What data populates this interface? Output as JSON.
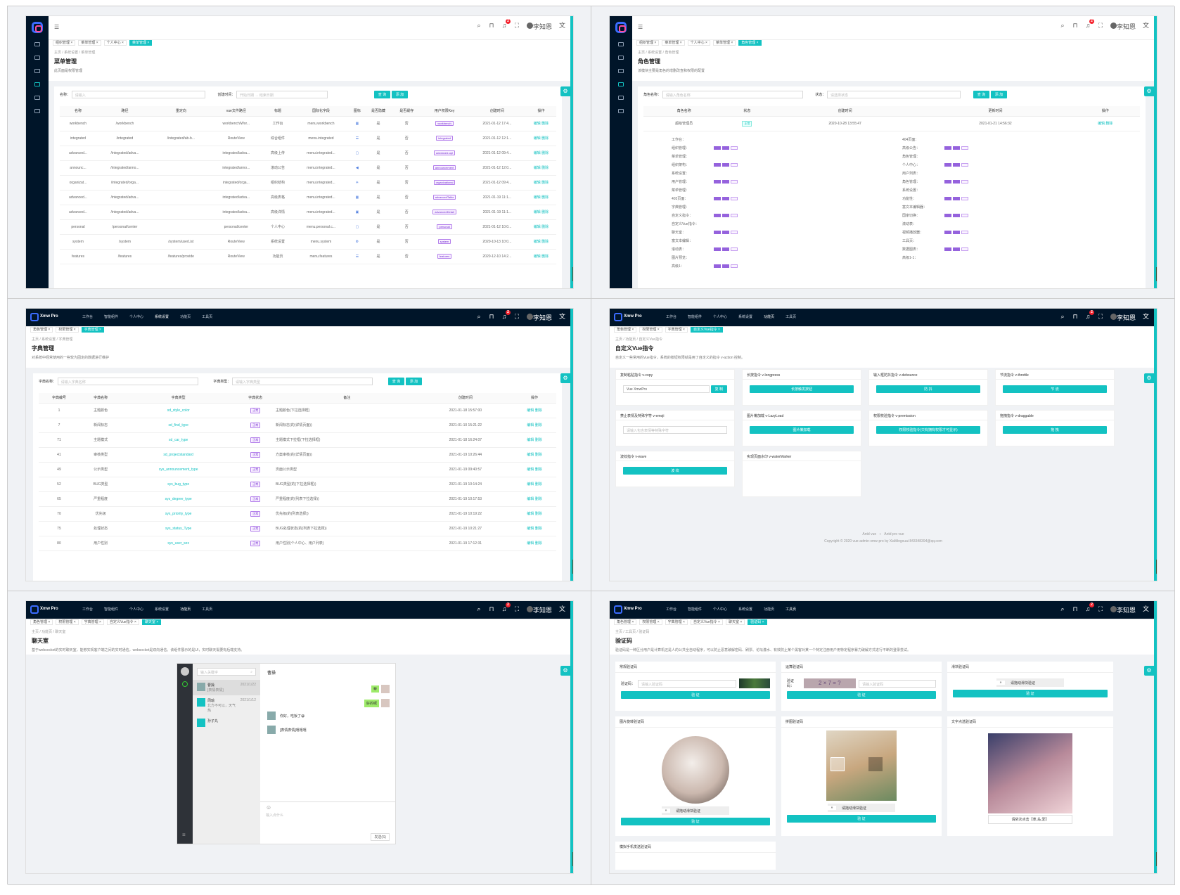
{
  "common": {
    "user_name": "李知恩",
    "notice_count": "2",
    "brand": "Xmw Pro",
    "top_nav": [
      "工作台",
      "智能组件",
      "个人中心",
      "系统设置",
      "功能页",
      "工具页"
    ]
  },
  "p1": {
    "tabs": [
      "组织管理 ×",
      "菜单管理 ×",
      "个人中心 ×",
      "菜单管理 ×"
    ],
    "crumb": "主页 / 系统设置 / 菜单管理",
    "title": "菜单管理",
    "desc": "此页面是权限管理",
    "search": {
      "name_label": "名称：",
      "name_ph": "请输入",
      "time_label": "创建时间：",
      "start_ph": "开始日期",
      "end_ph": "结束日期",
      "query": "查 询",
      "add": "添 加"
    },
    "columns": [
      "名称",
      "路径",
      "重定向",
      "vue文件路径",
      "标题",
      "国际化字段",
      "图标",
      "是否隐藏",
      "是否缓存",
      "用户权限Key",
      "创建时间",
      "操作"
    ],
    "rows": [
      [
        "workbench",
        "/workbench",
        "",
        "workbench/Wor...",
        "工作台",
        "menu.workbench",
        "",
        "是",
        "否",
        "workbench",
        "2021-01-12 17:4...",
        "编辑",
        "删除"
      ],
      [
        "integrated",
        "/integrated",
        "/integrated/ab-b...",
        "RouteView",
        "综合组件",
        "menu.integrated",
        "",
        "是",
        "否",
        "integrated",
        "2021-01-12 12:1...",
        "编辑",
        "删除"
      ],
      [
        "advanced...",
        "/integrated/adva...",
        "",
        "integrated/adva...",
        "高级上传",
        "menu.integrated...",
        "",
        "是",
        "否",
        "advanced-upl",
        "2021-01-12 09:4...",
        "编辑",
        "删除"
      ],
      [
        "announc...",
        "/integrated/anno...",
        "",
        "integrated/anno...",
        "滚动公告",
        "menu.integrated...",
        "",
        "是",
        "否",
        "announcement",
        "2021-01-12 12:0...",
        "编辑",
        "删除"
      ],
      [
        "organizat...",
        "/integrated/orga...",
        "",
        "integrated/orga...",
        "组织结构",
        "menu.integrated...",
        "",
        "是",
        "否",
        "organizational",
        "2021-01-12 09:4...",
        "编辑",
        "删除"
      ],
      [
        "advanced...",
        "/integrated/adva...",
        "",
        "integrated/adva...",
        "高级表格",
        "menu.integrated...",
        "",
        "是",
        "否",
        "advancedTable",
        "2021-01-19 11:1...",
        "编辑",
        "删除"
      ],
      [
        "advanced...",
        "/integrated/adva...",
        "",
        "integrated/adva...",
        "高级详情",
        "menu.integrated...",
        "",
        "是",
        "否",
        "advancedDetail",
        "2021-01-19 11:1...",
        "编辑",
        "删除"
      ],
      [
        "personal",
        "/personal/center",
        "",
        "personal/center",
        "个人中心",
        "menu.personal.c...",
        "",
        "是",
        "否",
        "personal",
        "2021-01-12 10:0...",
        "编辑",
        "删除"
      ],
      [
        "system",
        "/system",
        "/system/userList",
        "RouteView",
        "系统设置",
        "menu.system",
        "",
        "是",
        "否",
        "system",
        "2020-10-13 10:0...",
        "编辑",
        "删除"
      ],
      [
        "features",
        "/features",
        "/features/provide",
        "RouteView",
        "功能页",
        "menu.features",
        "",
        "是",
        "否",
        "features",
        "2020-12-10 14:2...",
        "编辑",
        "删除"
      ]
    ]
  },
  "p2": {
    "tabs": [
      "组织管理 ×",
      "菜单管理 ×",
      "个人中心 ×",
      "菜单管理 ×",
      "角色管理 ×"
    ],
    "crumb": "主页 / 系统设置 / 角色管理",
    "title": "角色管理",
    "desc": "该模块主要是角色的增删改查和权限的配置",
    "search": {
      "name_label": "角色名称：",
      "name_ph": "请输入角色名称",
      "state_label": "状态：",
      "state_ph": "请选择状态",
      "query": "查 询",
      "add": "添 加"
    },
    "columns": [
      "角色名称",
      "状态",
      "创建时间",
      "更新时间",
      "操作"
    ],
    "row": [
      "超级管理员",
      "正常",
      "2020-10-28 13:55:47",
      "2021-01-21 14:56:32",
      "编辑",
      "删除"
    ],
    "left_perms": [
      "工作台：",
      "组织管理：",
      "菜单管理：",
      "组织架构：",
      "系统设置：",
      "用户管理：",
      "菜单管理：",
      "403页面：",
      "字典管理：",
      "自定义指令：",
      "自定义Vue指令：",
      "聊天室：",
      "富文本编辑：",
      "滚动表：",
      "图片预览：",
      "高级1："
    ],
    "right_perms": [
      "404页面：",
      "高级公告：",
      "角色管理：",
      "个人中心：",
      "用户列表：",
      "角色管理：",
      "系统设置：",
      "功能性：",
      "富文本编辑器：",
      "国家切换：",
      "滚动表：",
      "视频播放器：",
      "工具页：",
      "数据图表：",
      "高级1-1："
    ]
  },
  "p3": {
    "tabs": [
      "角色管理 ×",
      "权限管理 ×",
      "字典管理 ×"
    ],
    "crumb": "主页 / 系统设置 / 字典管理",
    "title": "字典管理",
    "desc": "对系统中经常使用的一些较为固定的数据进行维护",
    "search": {
      "name_label": "字典名称：",
      "name_ph": "请输入字典名称",
      "type_label": "字典类型：",
      "type_ph": "请输入字典类型",
      "query": "查 询",
      "add": "添 加"
    },
    "columns": [
      "字典编号",
      "字典名称",
      "字典类型",
      "字典状态",
      "备注",
      "创建时间",
      "操作"
    ],
    "rows": [
      [
        "1",
        "主题颜色",
        "sd_style_color",
        "正常",
        "主题颜色(下拉选择框)",
        "2021-01-18 15:57:00"
      ],
      [
        "7",
        "新闻标志",
        "sd_find_type",
        "正常",
        "新闻标志(的(详情页面))",
        "2021-01-10 15:21:22"
      ],
      [
        "71",
        "主题模式",
        "sd_car_type",
        "正常",
        "主题模式下拉框(下拉选择框)",
        "2021-01-18 16:24:07"
      ],
      [
        "41",
        "审核类型",
        "sd_projectstandard",
        "正常",
        "方案审核(的(详情页面))",
        "2021-01-19 10:26:44"
      ],
      [
        "49",
        "公示类型",
        "sys_announcement_type",
        "正常",
        "页面公示类型",
        "2021-01-19 09:40:57"
      ],
      [
        "52",
        "BUG类型",
        "sys_bug_type",
        "正常",
        "BUG类型(的(下拉选择框))",
        "2021-01-19 10:14:24"
      ],
      [
        "65",
        "严重程度",
        "sys_degree_type",
        "正常",
        "严重程度(的(列表下拉选择))",
        "2021-01-19 10:17:53"
      ],
      [
        "70",
        "优先级",
        "sys_priority_type",
        "正常",
        "优先级(的(列表选择))",
        "2021-01-19 10:19:22"
      ],
      [
        "75",
        "处理状态",
        "sys_status_Type",
        "正常",
        "BUG处理状态(的(列表下拉选择))",
        "2021-01-19 10:21:27"
      ],
      [
        "80",
        "用户性别",
        "sys_user_sex",
        "正常",
        "用户性别(个人中心、用户列表)",
        "2021-01-19 17:12:31"
      ]
    ],
    "edit": "编辑",
    "del": "删除"
  },
  "p4": {
    "tabs": [
      "角色管理 ×",
      "权限管理 ×",
      "字典管理 ×",
      "自定义Vue指令 ×"
    ],
    "crumb": "主页 / 功能页 / 自定义Vue指令",
    "title": "自定义Vue指令",
    "desc": "自定义一些常用的Vue指令，系统的按钮权限就是用了自定义的指令 v-action 控制。",
    "boxes": [
      {
        "title": "复制粘贴指令 v-copy",
        "input": "Vue XmwPro",
        "btn": "复 制"
      },
      {
        "title": "长按指令 v-longpress",
        "btn": "长按触发按钮"
      },
      {
        "title": "输入框防抖指令 v-debounce",
        "btn": "防 抖"
      },
      {
        "title": "节流指令 v-throttle",
        "btn": "节 流"
      },
      {
        "title": "禁止表情及特殊字符 v-emoji",
        "input": "请输入包含表情等特殊字符",
        "btn": ""
      },
      {
        "title": "图片懒加载 v-LazyLoad",
        "btn": "图片懒加载"
      },
      {
        "title": "权限校验指令 v-premission",
        "btn": "权限校验指令(只有拥有权限才可显示)"
      },
      {
        "title": "拖拽指令 v-draggable",
        "btn": "拖 拽"
      },
      {
        "title": "波纹指令 v-wave",
        "btn": "波 纹"
      },
      {
        "title": "实现页面水印 v-waterMarker",
        "btn": ""
      }
    ],
    "footer_links": [
      "Antd vue",
      "Antd pro vue"
    ],
    "copyright": "Copyright © 2020 vue-admin-xmw-pro by XiaMingxuai 843348394@qq.com"
  },
  "p5": {
    "tabs": [
      "角色管理 ×",
      "权限管理 ×",
      "字典管理 ×",
      "自定义Vue指令 ×",
      "聊天室 ×"
    ],
    "crumb": "主页 / 功能页 / 聊天室",
    "title": "聊天室",
    "desc": "基于websocket的实时聊天室，能够实现客户端之间的实时通信，websocket是双向通信。该组件展示的是UI，实时聊天需要有后端支持。",
    "search_ph": "输入关键字",
    "contacts": [
      {
        "name": "曹操",
        "time": "2021/1/22",
        "msg": "[表情表情]"
      },
      {
        "name": "周瑜",
        "time": "2021/1/12",
        "msg": "北方不可以，天气热"
      },
      {
        "name": "孙子丸",
        "time": "",
        "msg": ""
      }
    ],
    "current": "曹操",
    "messages": [
      "你好，吃饭了😀",
      "[表情表情]嘻嘻嘻"
    ],
    "mine": [
      "😀",
      "好的呢"
    ],
    "input_ph": "输入点什么",
    "send": "发送(S)"
  },
  "p6": {
    "tabs": [
      "角色管理 ×",
      "权限管理 ×",
      "字典管理 ×",
      "自定义Vue指令 ×",
      "聊天室 ×",
      "验证码 ×"
    ],
    "crumb": "主页 / 工具页 / 验证码",
    "title": "验证码",
    "desc": "验证码是一种区分用户是计算机还是人的公共全自动程序，可以防止恶意破解密码、刷票、论坛灌水、有效防止某个黑客对某一个特定注册用户用特定程序暴力破解方式进行不断的登录尝试。",
    "boxes": [
      {
        "title": "常规验证码",
        "label": "验证码：",
        "ph": "请输入验证码",
        "btn": "验 证"
      },
      {
        "title": "运算验证码",
        "label": "验证码：",
        "expr": "2 × 7 = ?",
        "ph": "请输入验证码",
        "btn": "验 证"
      },
      {
        "title": "滑块验证码",
        "slider": "请拖动滑块验证",
        "btn": "验 证"
      },
      {
        "title": "图片旋转验证码",
        "slider": "请拖动滑块验证",
        "btn": "验 证"
      },
      {
        "title": "拼图验证码",
        "slider": "请拖动滑块验证",
        "btn": "验 证"
      },
      {
        "title": "文字点选验证码",
        "hint": "请依次点击【萃,岛,爱】"
      },
      {
        "title": "模拟手机发送验证码"
      }
    ]
  }
}
